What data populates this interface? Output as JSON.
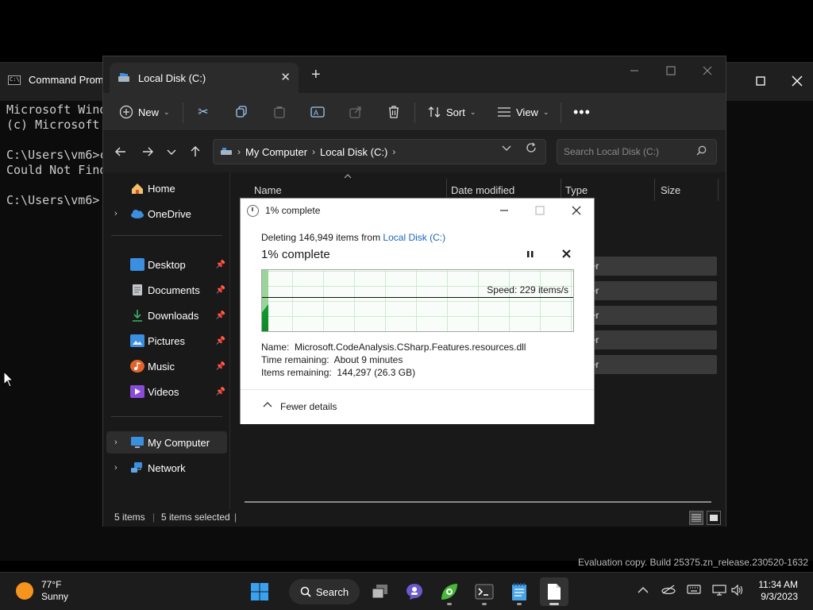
{
  "cmd": {
    "title": "Command Prompt",
    "lines": [
      "Microsoft Windows",
      "(c) Microsoft",
      "",
      "C:\\Users\\vm6>c",
      "Could Not Find",
      "",
      "C:\\Users\\vm6>"
    ]
  },
  "explorer": {
    "tab_title": "Local Disk (C:)",
    "toolbar": {
      "new_label": "New",
      "sort_label": "Sort",
      "view_label": "View"
    },
    "breadcrumb": [
      "My Computer",
      "Local Disk (C:)"
    ],
    "search_placeholder": "Search Local Disk (C:)",
    "nav": {
      "home": "Home",
      "onedrive": "OneDrive",
      "desktop": "Desktop",
      "documents": "Documents",
      "downloads": "Downloads",
      "pictures": "Pictures",
      "music": "Music",
      "videos": "Videos",
      "my_computer": "My Computer",
      "network": "Network"
    },
    "columns": {
      "name": "Name",
      "date_modified": "Date modified",
      "type": "Type",
      "size": "Size"
    },
    "row_type_partial": [
      "der",
      "der",
      "der",
      "der",
      "der"
    ],
    "status": {
      "count": "5 items",
      "selected": "5 items selected"
    }
  },
  "dialog": {
    "title": "1% complete",
    "desc_prefix": "Deleting 146,949 items from ",
    "desc_link": "Local Disk (C:)",
    "heading": "1% complete",
    "progress_percent": 1,
    "speed_label": "Speed: 229 items/s",
    "details": {
      "name_label": "Name:",
      "name_value": "Microsoft.CodeAnalysis.CSharp.Features.resources.dll",
      "time_label": "Time remaining:",
      "time_value": "About 9 minutes",
      "items_label": "Items remaining:",
      "items_value": "144,297 (26.3 GB)"
    },
    "fewer_details": "Fewer details"
  },
  "watermark": "Evaluation copy. Build 25375.zn_release.230520-1632",
  "taskbar": {
    "weather_temp": "77°F",
    "weather_desc": "Sunny",
    "search_label": "Search",
    "time": "11:34 AM",
    "date": "9/3/2023"
  },
  "colors": {
    "accent": "#1a66b8",
    "progress_green": "#0f9d2f",
    "explorer_bg": "#191919"
  }
}
